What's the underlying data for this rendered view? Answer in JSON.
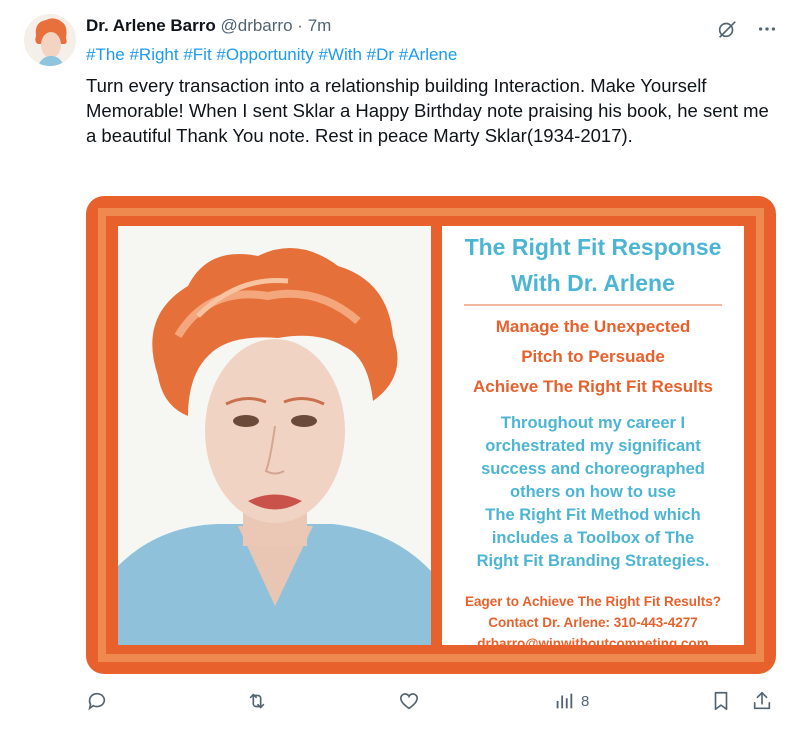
{
  "tweet": {
    "author_name": "Dr. Arlene Barro",
    "handle": "@drbarro",
    "separator": "·",
    "time": "7m",
    "hashtags": "#The #Right #Fit #Opportunity #With #Dr #Arlene",
    "text": "Turn every transaction into a relationship building Interaction. Make Yourself Memorable! When I sent Sklar a Happy Birthday note praising his book, he sent me a beautiful Thank You note. Rest in peace Marty Sklar(1934-2017)."
  },
  "card": {
    "title_line1": "The Right Fit Response",
    "title_line2": "With Dr. Arlene",
    "bullets": [
      "Manage the Unexpected",
      "Pitch to Persuade",
      "Achieve The Right Fit Results"
    ],
    "body_lines": [
      "Throughout my career I",
      "orchestrated my significant",
      "success and choreographed",
      "others on how to use",
      "The Right Fit Method which",
      "includes a Toolbox of The",
      "Right Fit Branding Strategies."
    ],
    "cta": "Eager to Achieve The Right Fit Results?",
    "contact": "Contact Dr. Arlene: 310-443-4277",
    "email": "drbarro@winwithoutcompeting.com"
  },
  "actions": {
    "views_count": "8"
  },
  "icons": [
    "grok-icon",
    "more-icon",
    "reply-icon",
    "retweet-icon",
    "like-icon",
    "views-icon",
    "bookmark-icon",
    "share-icon"
  ],
  "colors": {
    "accent_blue": "#1d9bf0",
    "card_orange": "#e8612c",
    "card_teal": "#4cb5d4",
    "muted": "#536471"
  }
}
